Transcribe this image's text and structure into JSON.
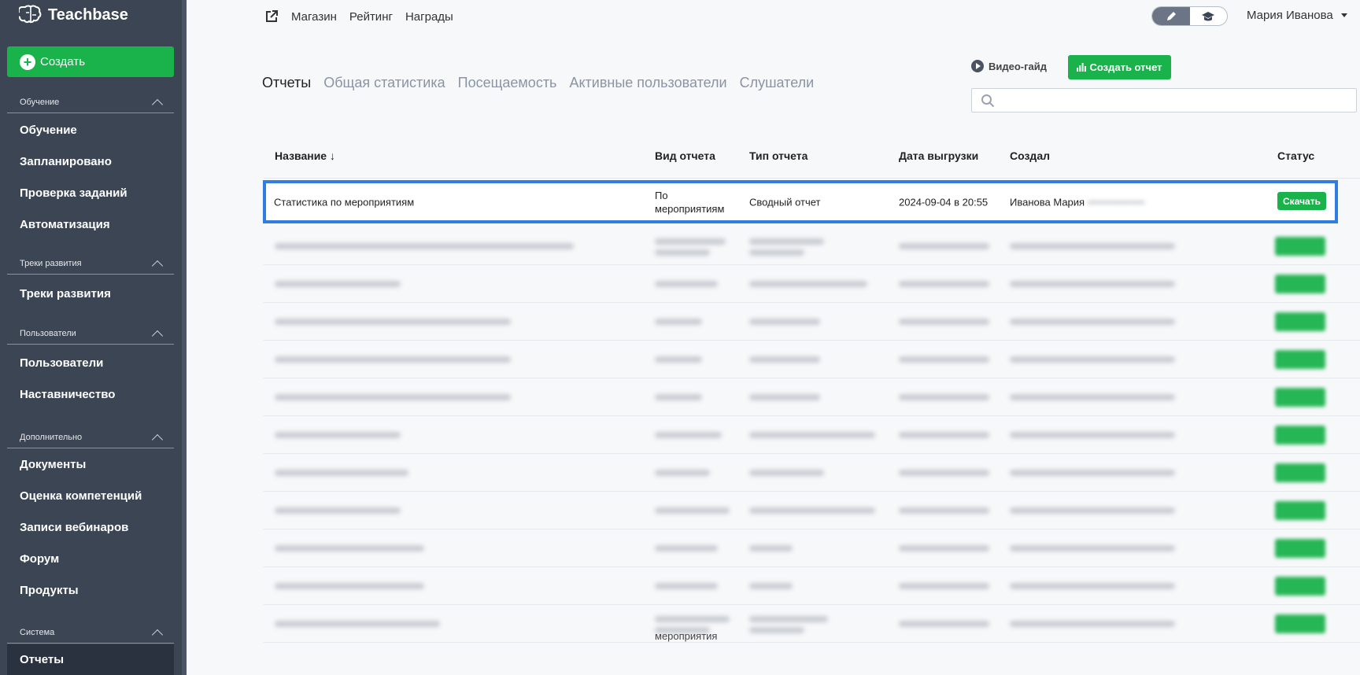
{
  "brand": {
    "name": "Teachbase",
    "accent": "#1ab24b",
    "sidebar_bg": "#3b4554"
  },
  "sidebar": {
    "create_label": "Создать",
    "sections": [
      {
        "title": "Обучение",
        "items": [
          "Обучение",
          "Запланировано",
          "Проверка заданий",
          "Автоматизация"
        ]
      },
      {
        "title": "Треки развития",
        "items": [
          "Треки развития"
        ]
      },
      {
        "title": "Пользователи",
        "items": [
          "Пользователи",
          "Наставничество"
        ]
      },
      {
        "title": "Дополнительно",
        "items": [
          "Документы",
          "Оценка компетенций",
          "Записи вебинаров",
          "Форум",
          "Продукты"
        ]
      },
      {
        "title": "Система",
        "items": [
          "Отчеты"
        ]
      }
    ],
    "active_item": "Отчеты"
  },
  "topnav": {
    "links": [
      "Магазин",
      "Рейтинг",
      "Награды"
    ],
    "user_name": "Мария Иванова",
    "mode_icons": [
      "pencil-icon",
      "graduation-cap-icon"
    ]
  },
  "tabs": [
    {
      "label": "Отчеты",
      "active": true
    },
    {
      "label": "Общая статистика",
      "active": false
    },
    {
      "label": "Посещаемость",
      "active": false
    },
    {
      "label": "Активные пользователи",
      "active": false
    },
    {
      "label": "Слушатели",
      "active": false
    }
  ],
  "toolbar": {
    "video_guide": "Видео-гайд",
    "create_report": "Создать отчет",
    "search_placeholder": ""
  },
  "table": {
    "headers": {
      "name": "Название ↓",
      "kind": "Вид отчета",
      "type": "Тип отчета",
      "date": "Дата выгрузки",
      "author": "Создал",
      "status": "Статус"
    },
    "first_row": {
      "name": "Статистика по мероприятиям",
      "kind_line1": "По",
      "kind_line2": "мероприятиям",
      "type": "Сводный отчет",
      "date": "2024-09-04 в 20:55",
      "author": "Иванова Мария",
      "status_button": "Скачать"
    },
    "last_row_kind_visible": "мероприятия",
    "blurred_rows_count": 11
  }
}
